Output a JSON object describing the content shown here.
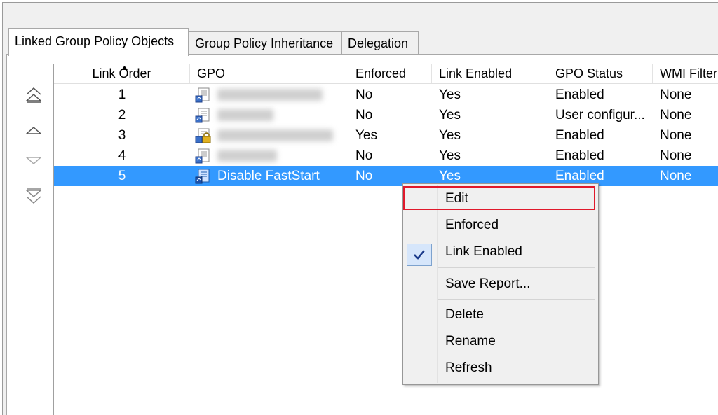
{
  "tabs": [
    {
      "label": "Linked Group Policy Objects"
    },
    {
      "label": "Group Policy Inheritance"
    },
    {
      "label": "Delegation"
    }
  ],
  "columns": [
    "Link Order",
    "GPO",
    "Enforced",
    "Link Enabled",
    "GPO Status",
    "WMI Filter"
  ],
  "rows": [
    {
      "order": "1",
      "gpo": "",
      "enforced": "No",
      "link_enabled": "Yes",
      "status": "Enabled",
      "wmi": "None"
    },
    {
      "order": "2",
      "gpo": "",
      "enforced": "No",
      "link_enabled": "Yes",
      "status": "User configur...",
      "wmi": "None"
    },
    {
      "order": "3",
      "gpo": "",
      "enforced": "Yes",
      "link_enabled": "Yes",
      "status": "Enabled",
      "wmi": "None"
    },
    {
      "order": "4",
      "gpo": "",
      "enforced": "No",
      "link_enabled": "Yes",
      "status": "Enabled",
      "wmi": "None"
    },
    {
      "order": "5",
      "gpo": "Disable FastStart",
      "enforced": "No",
      "link_enabled": "Yes",
      "status": "Enabled",
      "wmi": "None"
    }
  ],
  "selected_row": 5,
  "context_menu": {
    "edit": "Edit",
    "enforced": "Enforced",
    "link_enabled": "Link Enabled",
    "save_report": "Save Report...",
    "delete": "Delete",
    "rename": "Rename",
    "refresh": "Refresh",
    "highlight_color": "#e0192b"
  },
  "colors": {
    "selection": "#3399ff",
    "selection_text": "#ffffff"
  },
  "icons": [
    "move-to-top-icon",
    "move-up-icon",
    "move-down-icon",
    "move-to-bottom-icon",
    "gpo-icon",
    "gpo-enforced-lock-icon",
    "checkmark-icon",
    "sort-up-icon"
  ]
}
